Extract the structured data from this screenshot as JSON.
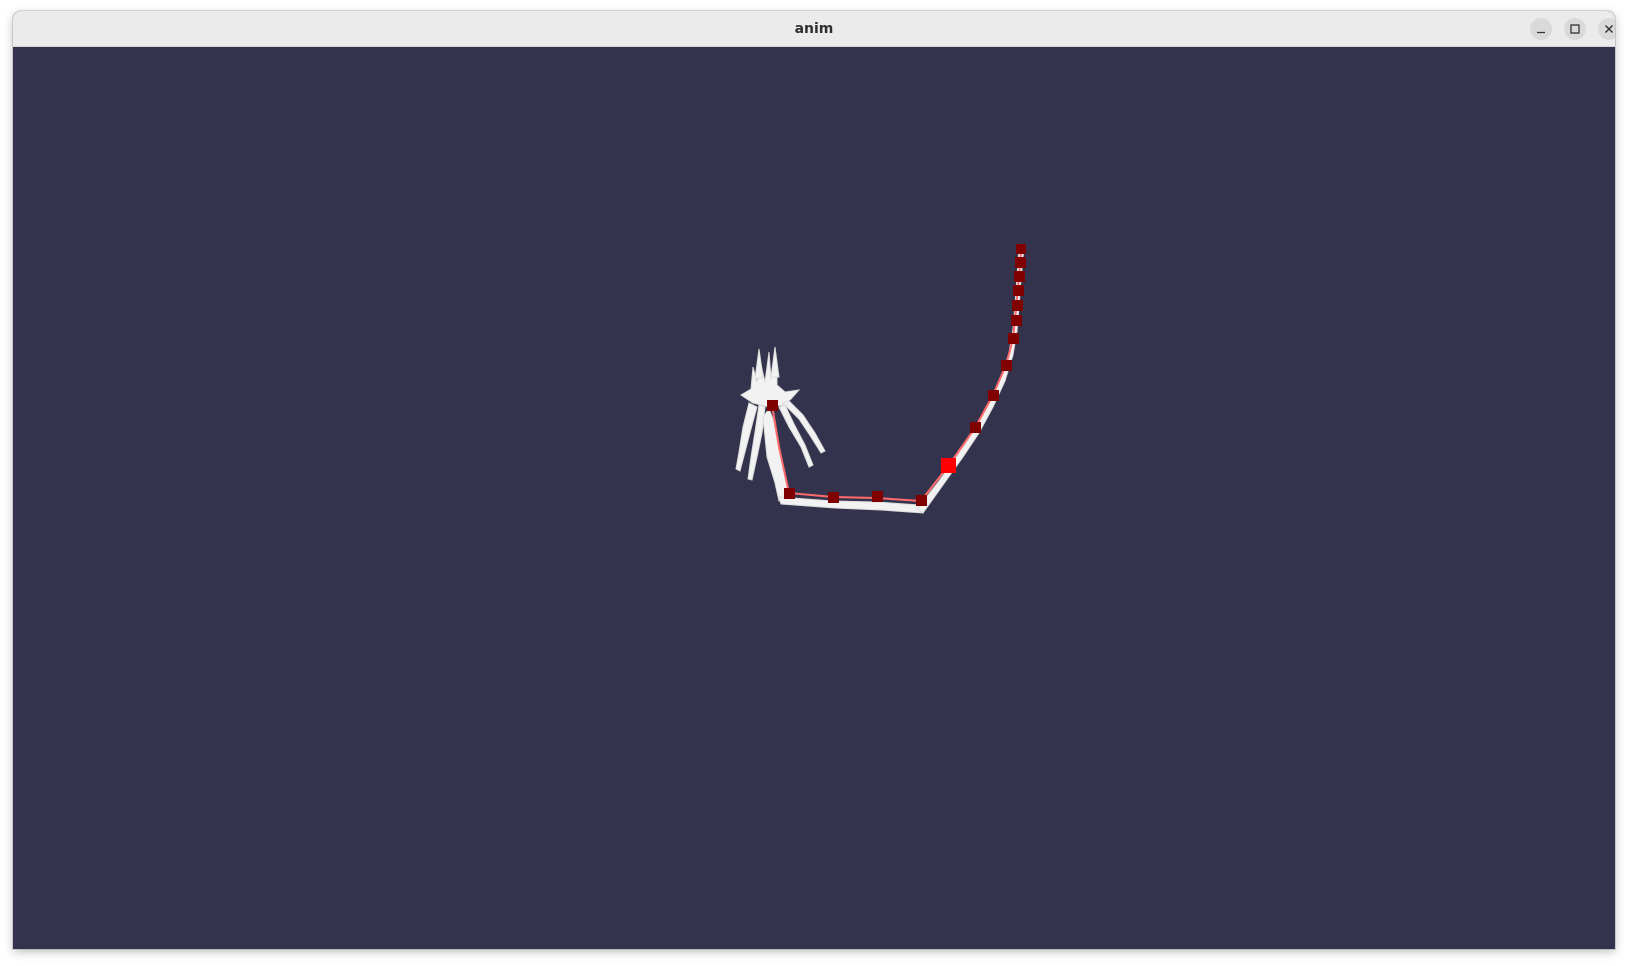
{
  "window": {
    "title": "anim",
    "controls": {
      "minimize_icon": "minimize-icon",
      "maximize_icon": "maximize-icon",
      "close_icon": "close-icon"
    }
  },
  "scene": {
    "background_color": "#34334d",
    "bone_color": "#ffffff",
    "joint_color": "#800000",
    "selected_joint_color": "#ff0000",
    "bone_line_color": "#ff6060"
  }
}
